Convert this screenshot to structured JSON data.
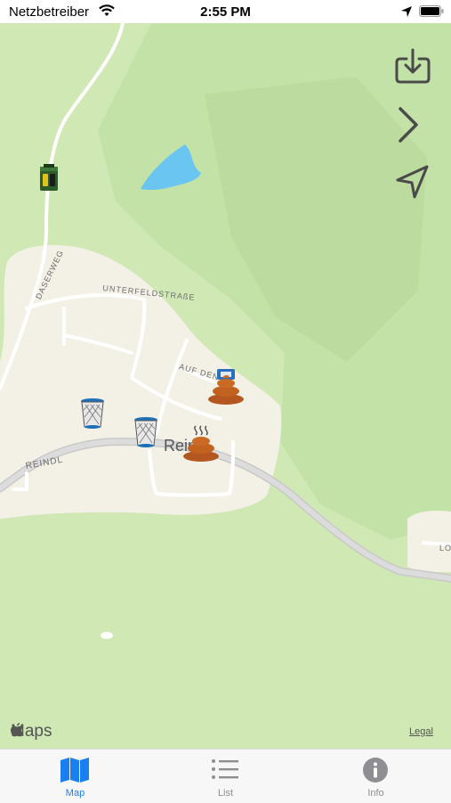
{
  "status_bar": {
    "carrier": "Netzbetreiber",
    "time": "2:55 PM"
  },
  "map": {
    "streets": [
      "DASERWEG",
      "UNTERFELDSTRAßE",
      "AUF DEN",
      "REINDL",
      "LO"
    ],
    "place": "Reindl",
    "brand": "Maps",
    "legal": "Legal",
    "markers": [
      "battery-bin-icon",
      "waste-basket-icon",
      "waste-basket-icon",
      "dog-poo-icon",
      "dog-poo-icon",
      "dog-bag-station-icon"
    ]
  },
  "controls": [
    "download-icon",
    "chevron-right-icon",
    "location-arrow-icon"
  ],
  "tabs": [
    {
      "label": "Map",
      "icon": "map-icon",
      "active": true
    },
    {
      "label": "List",
      "icon": "list-icon",
      "active": false
    },
    {
      "label": "Info",
      "icon": "info-icon",
      "active": false
    }
  ],
  "colors": {
    "accent": "#1a7ff0",
    "inactive": "#8e8e93",
    "land": "#cfe8b4",
    "settlement": "#f3f0e6",
    "water": "#6ac5f0"
  }
}
